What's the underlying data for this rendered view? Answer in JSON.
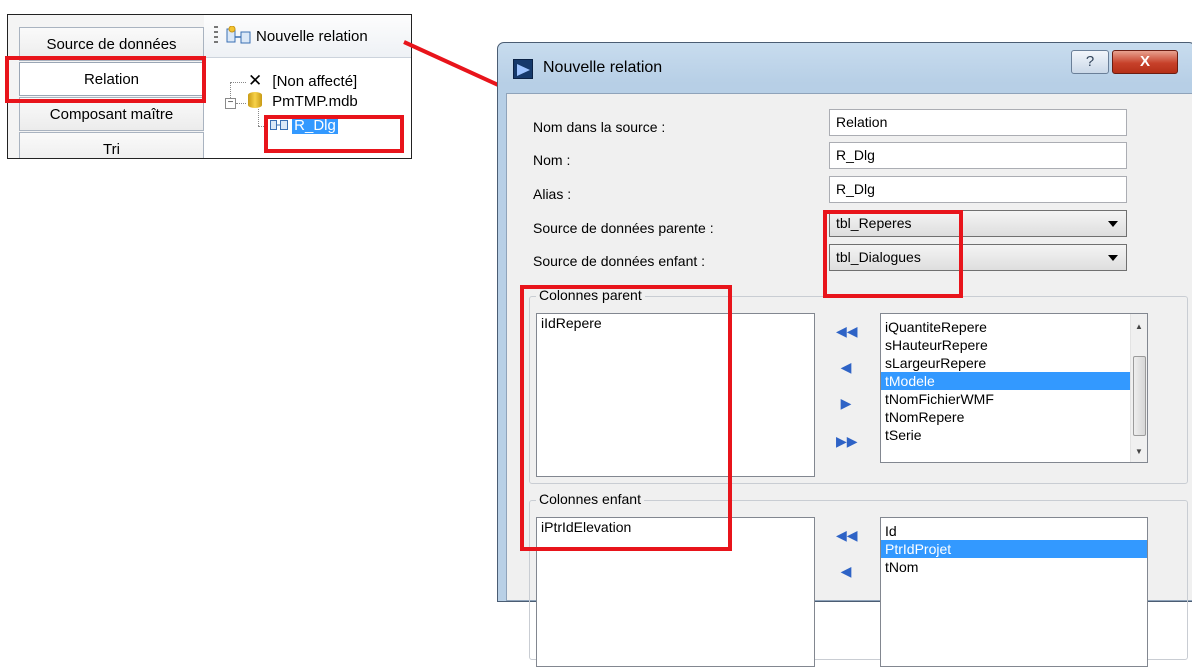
{
  "snippet": {
    "tabs": [
      "Source de données",
      "Relation",
      "Composant maître",
      "Tri"
    ],
    "toolbar_label": "Nouvelle relation",
    "tree": {
      "unassigned": "[Non affecté]",
      "database": "PmTMP.mdb",
      "relation": "R_Dlg"
    }
  },
  "dialog": {
    "title": "Nouvelle relation",
    "help_glyph": "?",
    "close_glyph": "X",
    "fields": {
      "source_name_label": "Nom dans la source :",
      "source_name_value": "Relation",
      "name_label": "Nom :",
      "name_value": "R_Dlg",
      "alias_label": "Alias :",
      "alias_value": "R_Dlg",
      "parent_source_label": "Source de données parente :",
      "parent_source_value": "tbl_Reperes",
      "child_source_label": "Source de données enfant :",
      "child_source_value": "tbl_Dialogues"
    },
    "parent_group": {
      "title": "Colonnes parent",
      "selected": [
        "iIdRepere"
      ],
      "available": [
        "iQuantiteRepere",
        "sHauteurRepere",
        "sLargeurRepere",
        "tModele",
        "tNomFichierWMF",
        "tNomRepere",
        "tSerie"
      ],
      "highlighted": "tModele"
    },
    "child_group": {
      "title": "Colonnes enfant",
      "selected": [
        "iPtrIdElevation"
      ],
      "available": [
        "Id",
        "PtrIdProjet",
        "tNom"
      ],
      "highlighted": "PtrIdProjet"
    },
    "move_buttons": {
      "all_left": "◀◀",
      "one_left": "◀",
      "one_right": "▶",
      "all_right": "▶▶"
    }
  },
  "colors": {
    "highlight": "#e8141b",
    "selection": "#3399ff",
    "arrow": "#e8141b"
  }
}
